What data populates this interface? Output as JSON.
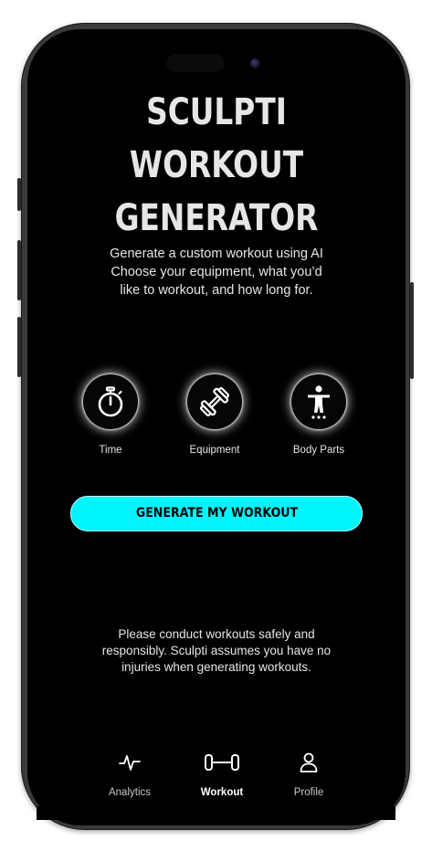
{
  "header": {
    "title_line1": "SCULPTI WORKOUT",
    "title_line2": "GENERATOR"
  },
  "intro": {
    "line1": "Generate a custom workout using AI",
    "line2": "Choose your equipment, what you’d",
    "line3": "like to workout, and how long for."
  },
  "features": [
    {
      "label": "Time",
      "icon": "stopwatch-icon"
    },
    {
      "label": "Equipment",
      "icon": "dumbbell-icon"
    },
    {
      "label": "Body Parts",
      "icon": "body-figure-icon"
    }
  ],
  "actions": {
    "generate_label": "GENERATE MY WORKOUT",
    "accent_color": "#00f5ff"
  },
  "disclaimer": {
    "line1": "Please conduct workouts safely and",
    "line2": "responsibly. Sculpti assumes you have no",
    "line3": "injuries when generating workouts."
  },
  "tabbar": {
    "items": [
      {
        "label": "Analytics",
        "icon": "pulse-icon",
        "active": false
      },
      {
        "label": "Workout",
        "icon": "barbell-icon",
        "active": true
      },
      {
        "label": "Profile",
        "icon": "person-icon",
        "active": false
      }
    ]
  }
}
